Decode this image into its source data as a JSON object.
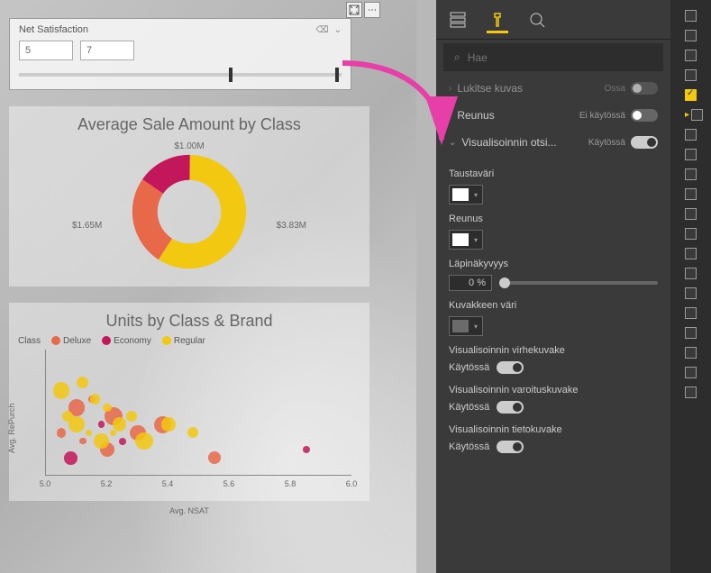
{
  "slicer": {
    "title": "Net Satisfaction",
    "from": "5",
    "to": "7",
    "thumb_left_pct": 65,
    "thumb_right_pct": 98
  },
  "donut": {
    "title": "Average Sale Amount by Class",
    "labels": {
      "top": "$1.00M",
      "left": "$1.65M",
      "right": "$3.83M"
    }
  },
  "scatter": {
    "title": "Units by Class & Brand",
    "legend_title": "Class",
    "legend": [
      {
        "name": "Deluxe",
        "color": "#e8684a"
      },
      {
        "name": "Economy",
        "color": "#c2185b"
      },
      {
        "name": "Regular",
        "color": "#f2c811"
      }
    ],
    "x_label": "Avg. NSAT",
    "y_label": "Avg. RePurch",
    "x_ticks": [
      "5.0",
      "5.2",
      "5.4",
      "5.6",
      "5.8",
      "6.0"
    ]
  },
  "chart_data": [
    {
      "type": "pie",
      "title": "Average Sale Amount by Class",
      "series": [
        {
          "name": "Regular",
          "value": 3.83,
          "color": "#f2c811"
        },
        {
          "name": "Deluxe",
          "value": 1.65,
          "color": "#e8684a"
        },
        {
          "name": "Economy",
          "value": 1.0,
          "color": "#c2185b"
        }
      ],
      "value_unit": "$M"
    },
    {
      "type": "scatter",
      "title": "Units by Class & Brand",
      "xlabel": "Avg. NSAT",
      "ylabel": "Avg. RePurch",
      "xlim": [
        5.0,
        6.0
      ],
      "series": [
        {
          "name": "Deluxe",
          "color": "#e8684a",
          "points": [
            [
              5.05,
              1.5
            ],
            [
              5.1,
              1.8
            ],
            [
              5.12,
              1.4
            ],
            [
              5.15,
              1.9
            ],
            [
              5.2,
              1.3
            ],
            [
              5.22,
              1.7
            ],
            [
              5.3,
              1.5
            ],
            [
              5.38,
              1.6
            ],
            [
              5.55,
              1.2
            ]
          ]
        },
        {
          "name": "Economy",
          "color": "#c2185b",
          "points": [
            [
              5.08,
              1.2
            ],
            [
              5.18,
              1.6
            ],
            [
              5.25,
              1.4
            ],
            [
              5.85,
              1.3
            ]
          ]
        },
        {
          "name": "Regular",
          "color": "#f2c811",
          "points": [
            [
              5.05,
              2.0
            ],
            [
              5.07,
              1.7
            ],
            [
              5.1,
              1.6
            ],
            [
              5.12,
              2.1
            ],
            [
              5.14,
              1.5
            ],
            [
              5.16,
              1.9
            ],
            [
              5.18,
              1.4
            ],
            [
              5.2,
              1.8
            ],
            [
              5.22,
              1.5
            ],
            [
              5.24,
              1.6
            ],
            [
              5.28,
              1.7
            ],
            [
              5.32,
              1.4
            ],
            [
              5.4,
              1.6
            ],
            [
              5.48,
              1.5
            ]
          ]
        }
      ]
    }
  ],
  "panel": {
    "search_placeholder": "Hae",
    "rows": {
      "lock": {
        "label": "Lukitse kuvas",
        "state": "Ossa"
      },
      "border": {
        "label": "Reunus",
        "state": "Ei käytössä"
      },
      "header": {
        "label": "Visualisoinnin otsi...",
        "state": "Käytössä"
      }
    },
    "sub": {
      "bg_color": "Taustaväri",
      "border": "Reunus",
      "opacity": "Läpinäkyvyys",
      "opacity_value": "0",
      "opacity_unit": "%",
      "icon_color": "Kuvakkeen väri",
      "error_icon": "Visualisoinnin virhekuvake",
      "warning_icon": "Visualisoinnin varoituskuvake",
      "info_icon": "Visualisoinnin tietokuvake",
      "on_label": "Käytössä"
    },
    "colors": {
      "bg": "#ffffff",
      "border": "#ffffff",
      "icon": "#6b6b6b"
    }
  }
}
